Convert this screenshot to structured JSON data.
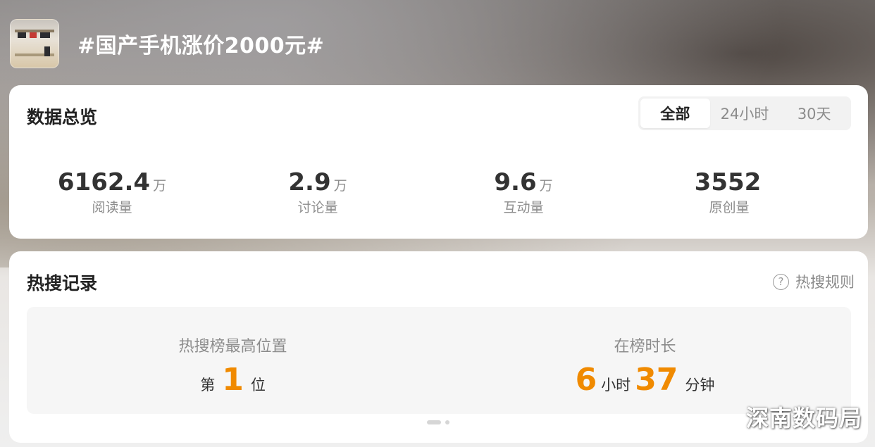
{
  "topic": {
    "title": "#国产手机涨价2000元#"
  },
  "overview": {
    "title": "数据总览",
    "tabs": [
      {
        "label": "全部",
        "active": true
      },
      {
        "label": "24小时",
        "active": false
      },
      {
        "label": "30天",
        "active": false
      }
    ],
    "stats": [
      {
        "value": "6162.4",
        "unit": "万",
        "label": "阅读量"
      },
      {
        "value": "2.9",
        "unit": "万",
        "label": "讨论量"
      },
      {
        "value": "9.6",
        "unit": "万",
        "label": "互动量"
      },
      {
        "value": "3552",
        "unit": "",
        "label": "原创量"
      }
    ]
  },
  "hot_search": {
    "title": "热搜记录",
    "rules_label": "热搜规则",
    "highest_position": {
      "label": "热搜榜最高位置",
      "prefix": "第",
      "value": "1",
      "suffix": "位"
    },
    "duration": {
      "label": "在榜时长",
      "hours": "6",
      "hours_unit": "小时",
      "minutes": "37",
      "minutes_unit": "分钟"
    }
  },
  "watermark": "深南数码局",
  "colors": {
    "accent": "#f08a00",
    "card_bg": "#ffffff",
    "panel_bg": "#f6f6f6"
  }
}
